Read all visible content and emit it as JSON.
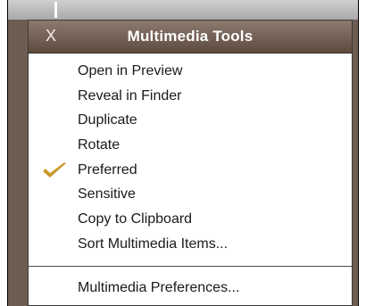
{
  "window": {
    "title": "Multimedia Tools",
    "close_glyph": "X"
  },
  "menu": {
    "items": [
      {
        "label": "Open in Preview",
        "checked": false
      },
      {
        "label": "Reveal in Finder",
        "checked": false
      },
      {
        "label": "Duplicate",
        "checked": false
      },
      {
        "label": "Rotate",
        "checked": false
      },
      {
        "label": "Preferred",
        "checked": true
      },
      {
        "label": "Sensitive",
        "checked": false
      },
      {
        "label": "Copy to Clipboard",
        "checked": false
      },
      {
        "label": "Sort Multimedia Items...",
        "checked": false
      }
    ],
    "footer_item": {
      "label": "Multimedia Preferences..."
    }
  },
  "colors": {
    "titlebar_top": "#8d7a6e",
    "titlebar_bottom": "#5e4b40",
    "checkmark": "#c99a2e",
    "background_frame": "#6e5d52"
  },
  "icons": {
    "close": "close-icon",
    "check": "checkmark-icon"
  }
}
